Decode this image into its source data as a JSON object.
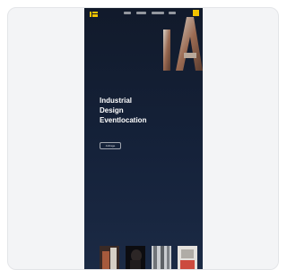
{
  "preview": {
    "nav": {
      "logo_icon": "ia-logo-icon",
      "links_count_hint": "nav-links",
      "cta_icon": "square-accent-icon"
    },
    "hero": {
      "art_icon": "ia-monogram-icon",
      "title_lines": [
        "Industrial",
        "Design",
        "Eventlocation"
      ],
      "button_label": "Anfrage"
    },
    "gallery": {
      "thumb_icons": [
        "photo-thumbnail-icon",
        "photo-thumbnail-icon",
        "photo-thumbnail-icon",
        "photo-thumbnail-icon"
      ]
    }
  },
  "colors": {
    "card_bg": "#f3f4f6",
    "site_bg": "#15223a",
    "accent": "#f2c200",
    "text": "#ffffff"
  }
}
